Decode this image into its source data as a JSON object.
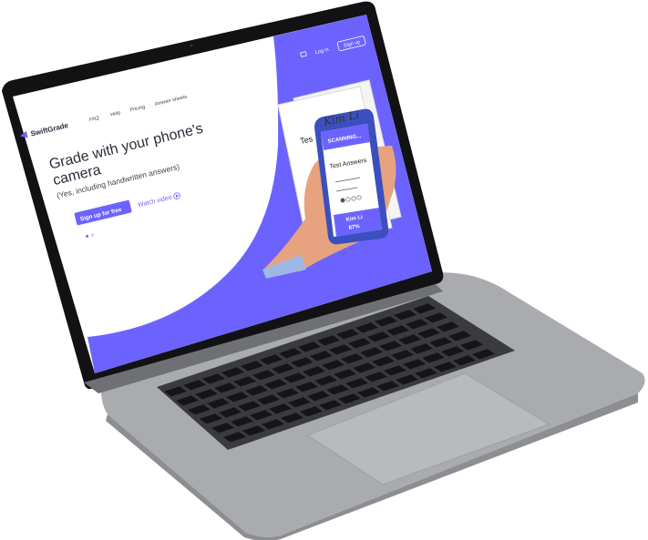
{
  "site": {
    "brand": "SwiftGrade",
    "nav": [
      "FAQ",
      "Help",
      "Pricing",
      "Answer sheets"
    ],
    "login": "Log in",
    "signup": "Sign up",
    "hero_title": "Grade with your phone's camera",
    "hero_subtitle": "(Yes, including handwritten answers)",
    "cta_primary": "Sign up for free",
    "cta_secondary": "Watch video",
    "phone": {
      "status": "SCANNING...",
      "card_title": "Test Answers",
      "student_name": "Kim Li",
      "score": "87%"
    },
    "paper": {
      "name": "Kim Li",
      "heading": "Tes"
    }
  },
  "colors": {
    "brand": "#6c63ff",
    "laptop_body": "#a7a9ad",
    "bezel": "#111111"
  },
  "icons": [
    "chat-icon",
    "play-icon",
    "logo-icon"
  ]
}
